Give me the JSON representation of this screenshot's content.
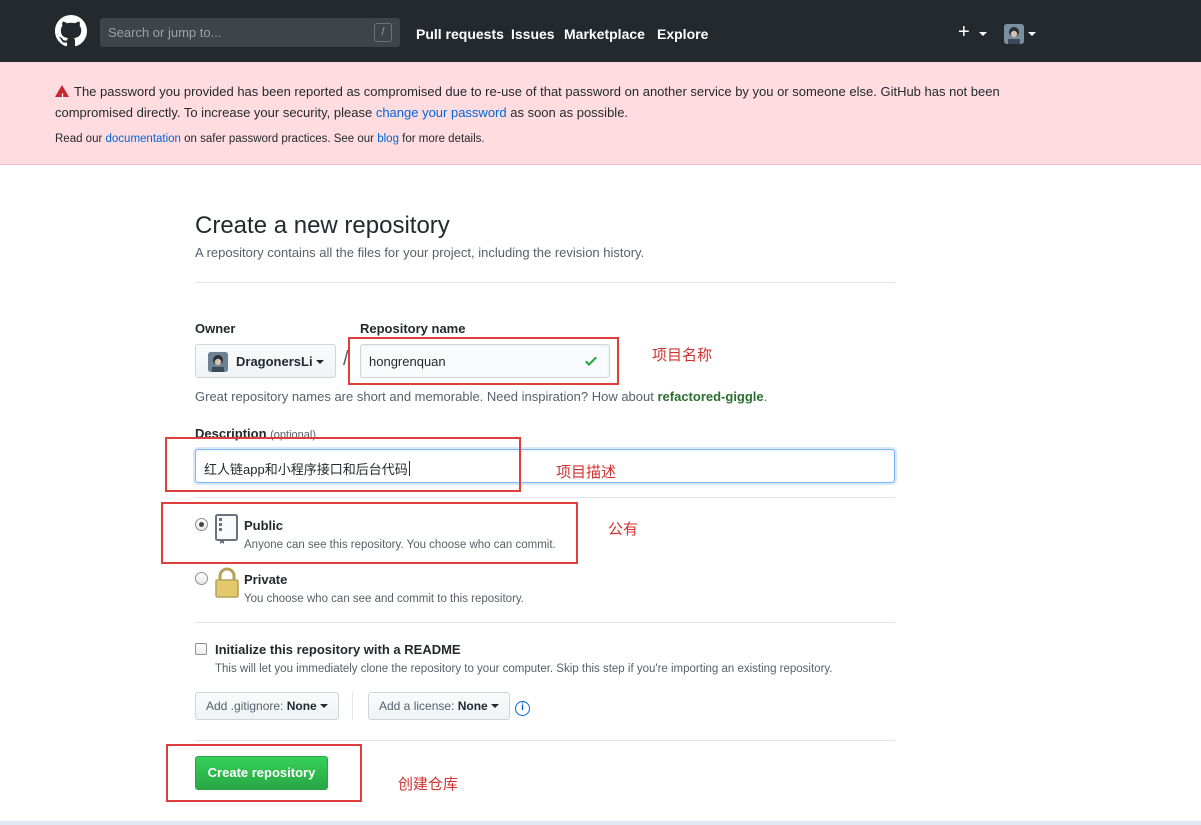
{
  "header": {
    "search_placeholder": "Search or jump to...",
    "search_key": "/",
    "nav": [
      "Pull requests",
      "Issues",
      "Marketplace",
      "Explore"
    ],
    "plus": "+"
  },
  "flash": {
    "msg_before": "The password you provided has been reported as compromised due to re-use of that password on another service by you or someone else. GitHub has not been compromised directly. To increase your security, please ",
    "msg_link": "change your password",
    "msg_after": " as soon as possible.",
    "sub_before": "Read our ",
    "sub_link1": "documentation",
    "sub_middle": " on safer password practices. See our ",
    "sub_link2": "blog",
    "sub_after": " for more details."
  },
  "page": {
    "title": "Create a new repository",
    "subtitle": "A repository contains all the files for your project, including the revision history."
  },
  "form": {
    "owner_label": "Owner",
    "owner_value": "DragonersLi",
    "slash": "/",
    "repo_label": "Repository name",
    "repo_value": "hongrenquan",
    "hint_before": "Great repository names are short and memorable. Need inspiration? How about ",
    "hint_suggestion": "refactored-giggle",
    "hint_after": ".",
    "description_label": "Description",
    "description_optional": "(optional)",
    "description_value": "红人链app和小程序接口和后台代码",
    "public_title": "Public",
    "public_desc": "Anyone can see this repository. You choose who can commit.",
    "private_title": "Private",
    "private_desc": "You choose who can see and commit to this repository.",
    "readme_title": "Initialize this repository with a README",
    "readme_desc": "This will let you immediately clone the repository to your computer. Skip this step if you're importing an existing repository.",
    "gitignore_label": "Add .gitignore:",
    "gitignore_value": "None",
    "license_label": "Add a license:",
    "license_value": "None",
    "info": "i",
    "submit": "Create repository"
  },
  "annotations": {
    "repo_name": "项目名称",
    "description": "项目描述",
    "public": "公有",
    "create": "创建仓库"
  },
  "colors": {
    "header_bg": "#24292e",
    "flash_bg": "#ffdce0",
    "link": "#0366d6",
    "submit_green": "#28a745",
    "annotation_red": "#d0332f"
  }
}
